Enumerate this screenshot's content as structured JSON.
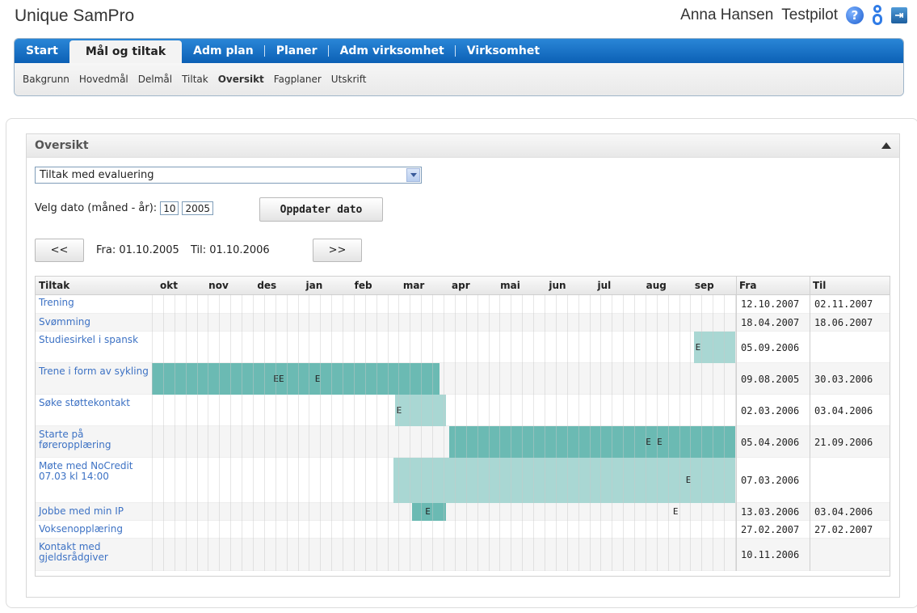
{
  "app": {
    "title": "Unique SamPro",
    "user": "Anna Hansen",
    "role": "Testpilot"
  },
  "icons": {
    "help": "help-icon",
    "user": "user-icon",
    "exit": "exit-icon"
  },
  "nav": {
    "tabs": [
      "Start",
      "Mål og tiltak",
      "Adm plan",
      "Planer",
      "Adm virksomhet",
      "Virksomhet"
    ],
    "active_tab": "Mål og tiltak",
    "subtabs": [
      "Bakgrunn",
      "Hovedmål",
      "Delmål",
      "Tiltak",
      "Oversikt",
      "Fagplaner",
      "Utskrift"
    ],
    "active_subtab": "Oversikt"
  },
  "panel": {
    "title": "Oversikt",
    "view_select": "Tiltak med evaluering",
    "date_label": "Velg dato (måned - år):",
    "month_value": "10",
    "year_value": "2005",
    "update_button": "Oppdater dato",
    "prev_button": "<<",
    "next_button": ">>",
    "from_text": "Fra: 01.10.2005",
    "to_text": "Til: 01.10.2006"
  },
  "gantt": {
    "col_task": "Tiltak",
    "col_from": "Fra",
    "col_to": "Til",
    "months": [
      "okt",
      "nov",
      "des",
      "jan",
      "feb",
      "mar",
      "apr",
      "mai",
      "jun",
      "jul",
      "aug",
      "sep"
    ],
    "colors": {
      "bar": "#6bbab3",
      "bar_light": "#a9d7d3"
    },
    "rows": [
      {
        "name": "Trening",
        "fra": "12.10.2007",
        "til": "02.11.2007",
        "bars": [],
        "marks": []
      },
      {
        "name": "Svømming",
        "fra": "18.04.2007",
        "til": "18.06.2007",
        "bars": [],
        "marks": []
      },
      {
        "name": "Studiesirkel i spansk",
        "fra": "05.09.2006",
        "til": "",
        "bars": [
          {
            "start": "05.09.2006",
            "end": "01.10.2006",
            "tone": "light"
          }
        ],
        "marks": [
          {
            "date": "05.09.2006",
            "text": "E"
          }
        ]
      },
      {
        "name": "Trene i form av sykling",
        "fra": "09.08.2005",
        "til": "30.03.2006",
        "bars": [
          {
            "start": "01.10.2005",
            "end": "30.03.2006",
            "tone": "dark"
          }
        ],
        "marks": [
          {
            "date": "15.12.2005",
            "text": "EE"
          },
          {
            "date": "10.01.2006",
            "text": "E"
          }
        ]
      },
      {
        "name": "Søke støttekontakt",
        "fra": "02.03.2006",
        "til": "03.04.2006",
        "bars": [
          {
            "start": "02.03.2006",
            "end": "03.04.2006",
            "tone": "light"
          }
        ],
        "marks": [
          {
            "date": "02.03.2006",
            "text": "E"
          }
        ]
      },
      {
        "name": "Starte på føreropplæring",
        "fra": "05.04.2006",
        "til": "21.09.2006",
        "bars": [
          {
            "start": "05.04.2006",
            "end": "01.10.2006",
            "tone": "dark"
          }
        ],
        "marks": [
          {
            "date": "05.08.2006",
            "text": "E"
          },
          {
            "date": "12.08.2006",
            "text": "E"
          }
        ]
      },
      {
        "name": "Møte med NoCredit 07.03 kl 14:00",
        "fra": "07.03.2006",
        "til": "",
        "bars": [
          {
            "start": "01.03.2006",
            "end": "01.10.2006",
            "tone": "light"
          }
        ],
        "marks": [
          {
            "date": "30.08.2006",
            "text": "E"
          }
        ]
      },
      {
        "name": "Jobbe med min IP",
        "fra": "13.03.2006",
        "til": "03.04.2006",
        "bars": [
          {
            "start": "13.03.2006",
            "end": "03.04.2006",
            "tone": "dark"
          }
        ],
        "marks": [
          {
            "date": "20.03.2006",
            "text": "E"
          },
          {
            "date": "22.08.2006",
            "text": "E"
          }
        ]
      },
      {
        "name": "Voksenopplæring",
        "fra": "27.02.2007",
        "til": "27.02.2007",
        "bars": [],
        "marks": []
      },
      {
        "name": "Kontakt med gjeldsrådgiver",
        "fra": "10.11.2006",
        "til": "",
        "bars": [],
        "marks": []
      }
    ]
  }
}
